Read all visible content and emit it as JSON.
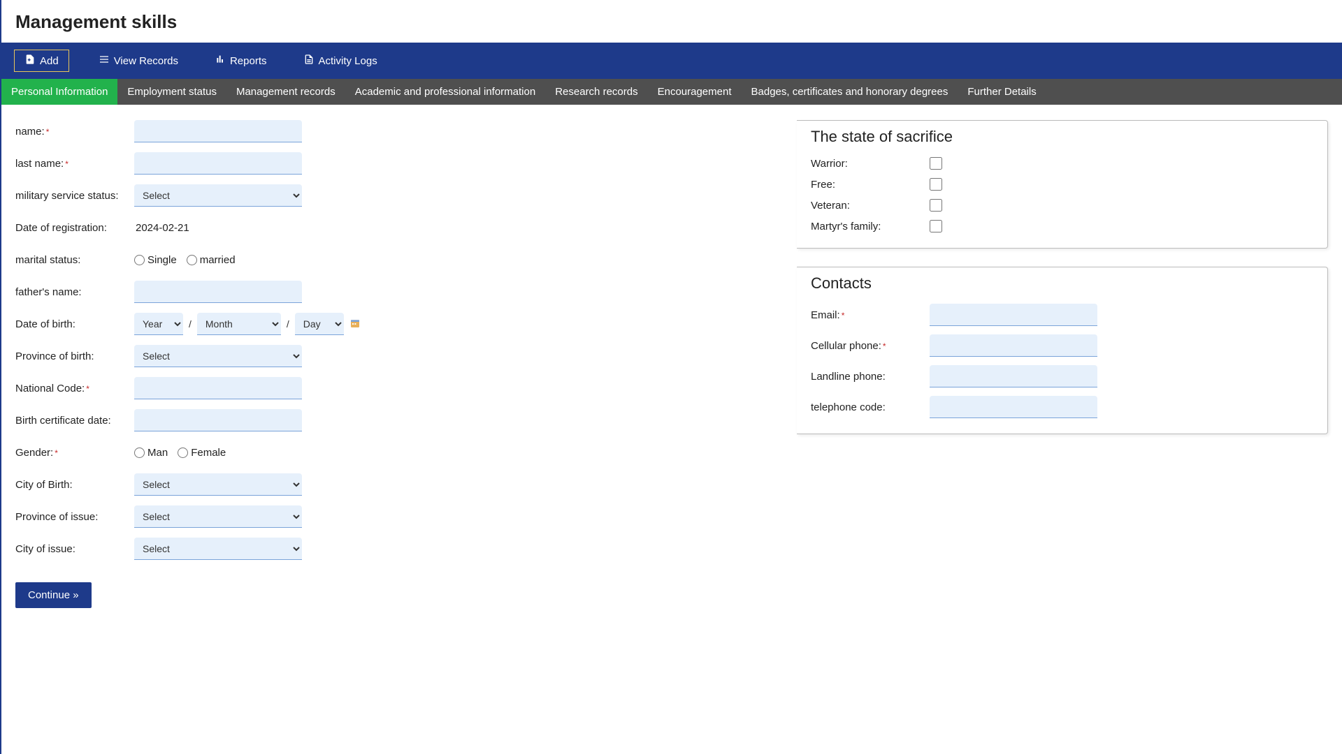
{
  "page_title": "Management skills",
  "toolbar": {
    "add": "Add",
    "view_records": "View Records",
    "reports": "Reports",
    "activity_logs": "Activity Logs"
  },
  "tabs": [
    "Personal Information",
    "Employment status",
    "Management records",
    "Academic and professional information",
    "Research records",
    "Encouragement",
    "Badges, certificates and honorary degrees",
    "Further Details"
  ],
  "active_tab_index": 0,
  "form": {
    "name_label": "name:",
    "last_name_label": "last name:",
    "military_label": "military service status:",
    "military_placeholder": "Select",
    "date_reg_label": "Date of registration:",
    "date_reg_value": "2024-02-21",
    "marital_label": "marital status:",
    "marital_single": "Single",
    "marital_married": "married",
    "father_label": "father's name:",
    "dob_label": "Date of birth:",
    "dob_year": "Year",
    "dob_month": "Month",
    "dob_day": "Day",
    "province_birth_label": "Province of birth:",
    "province_birth_placeholder": "Select",
    "national_code_label": "National Code:",
    "birth_cert_label": "Birth certificate date:",
    "gender_label": "Gender:",
    "gender_man": "Man",
    "gender_female": "Female",
    "city_birth_label": "City of Birth:",
    "city_birth_placeholder": "Select",
    "province_issue_label": "Province of issue:",
    "province_issue_placeholder": "Select",
    "city_issue_label": "City of issue:",
    "city_issue_placeholder": "Select",
    "continue": "Continue »"
  },
  "sacrifice": {
    "legend": "The state of sacrifice",
    "warrior": "Warrior:",
    "free": "Free:",
    "veteran": "Veteran:",
    "martyr": "Martyr's family:"
  },
  "contacts": {
    "legend": "Contacts",
    "email": "Email:",
    "cell": "Cellular phone:",
    "landline": "Landline phone:",
    "telcode": "telephone code:"
  }
}
